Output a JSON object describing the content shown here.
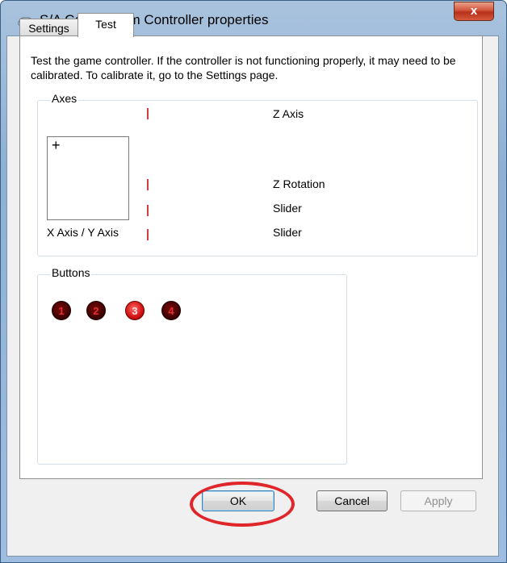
{
  "window": {
    "title": "S/A Combo. Sim Controller properties",
    "close_glyph": "x"
  },
  "tabs": [
    {
      "label": "Settings"
    },
    {
      "label": "Test"
    }
  ],
  "description": "Test the game controller.  If the controller is not functioning properly, it may need to be calibrated.  To calibrate it, go to the Settings page.",
  "axes_group": {
    "label": "Axes",
    "xy_label": "X Axis / Y Axis",
    "crosshair_glyph": "+",
    "axes": [
      {
        "label": "Z Axis"
      },
      {
        "label": "Z Rotation"
      },
      {
        "label": "Slider"
      },
      {
        "label": "Slider"
      }
    ]
  },
  "buttons_group": {
    "label": "Buttons",
    "buttons": [
      {
        "number": "1",
        "pressed": false
      },
      {
        "number": "2",
        "pressed": false
      },
      {
        "number": "3",
        "pressed": true
      },
      {
        "number": "4",
        "pressed": false
      }
    ]
  },
  "dialog_buttons": {
    "ok": "OK",
    "cancel": "Cancel",
    "apply": "Apply"
  },
  "colors": {
    "axis_bar": "#d04040",
    "button_idle": "#5a0000",
    "button_pressed": "#e02020",
    "highlight_ring": "#e0262b"
  }
}
